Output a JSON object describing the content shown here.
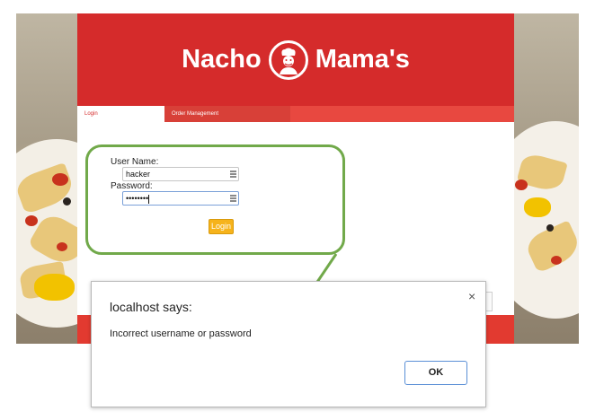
{
  "brand": {
    "word1": "Nacho",
    "word2": "Mama's"
  },
  "nav": {
    "tabs": [
      {
        "label": "Login"
      },
      {
        "label": "Order Management"
      }
    ]
  },
  "login_form": {
    "username_label": "User Name:",
    "username_value": "hacker",
    "password_label": "Password:",
    "password_value": "••••••••",
    "login_button": "Login"
  },
  "dialog": {
    "title": "localhost says:",
    "message": "Incorrect username or password",
    "ok_label": "OK",
    "close_glyph": "×"
  },
  "colors": {
    "brand_red": "#d52b2b",
    "nav_red": "#e84840",
    "login_orange": "#f6b31b",
    "annotation_green": "#71a94a",
    "ok_border": "#5a8fd6"
  },
  "icons": {
    "logo": "chef-logo-icon",
    "field": "autofill-key-icon",
    "close": "close-icon"
  }
}
